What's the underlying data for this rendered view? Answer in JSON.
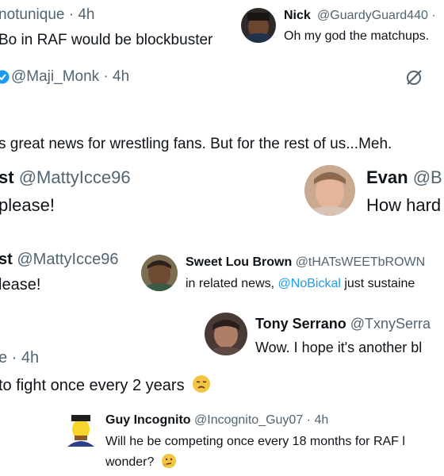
{
  "fragments": {
    "f1": {
      "handle_time": "notunique · 4h",
      "text": "Bo in RAF would be blockbuster"
    },
    "f2": {
      "name": "Nick",
      "handle_time": "@GuardyGuard440 ·",
      "text": "Oh my god the matchups."
    },
    "f3": {
      "handle_time": "@Maji_Monk · 4h"
    },
    "f4": {
      "text": "s great news for wrestling fans. But for the rest of us...Meh."
    },
    "f5": {
      "name": "st",
      "handle": "@MattyIcce96",
      "text": "please!"
    },
    "f6": {
      "name": "Evan",
      "handle": "@B",
      "text": "How hard"
    },
    "f7": {
      "name": "st",
      "handle": "@MattyIcce96",
      "text": "lease!"
    },
    "f8": {
      "name": "Sweet Lou Brown",
      "handle": "@tHATsWEETbROWN",
      "text_prefix": "in related news, ",
      "mention": "@NoBickal",
      "text_suffix": " just sustaine"
    },
    "f9": {
      "name": "Tony Serrano",
      "handle": "@TxnySerra",
      "text": "Wow. I hope it's another bl"
    },
    "f10": {
      "handle_time": "e · 4h",
      "text": "to fight once every 2 years",
      "emoji": "😞"
    },
    "f11": {
      "name": "Guy Incognito",
      "handle_time": "@Incognito_Guy07 · 4h",
      "line1": "Will he be competing once every 18 months for RAF l",
      "line2": "wonder?",
      "emoji": "🤔"
    }
  },
  "icons": {
    "grok": "slashed-circle-icon",
    "verified": "verified-badge-icon"
  },
  "colors": {
    "text": "#0f1419",
    "meta": "#536471",
    "link": "#1d9bf0",
    "verified": "#1d9bf0"
  }
}
